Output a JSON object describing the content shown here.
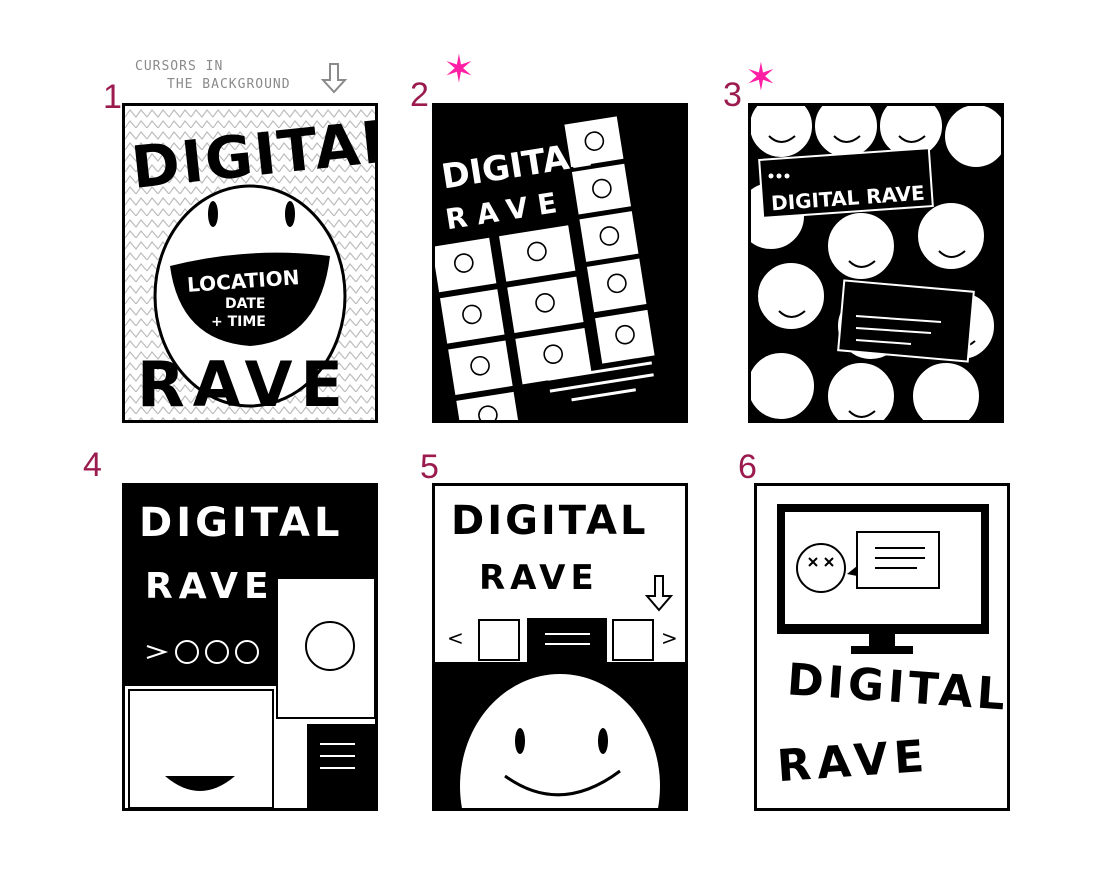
{
  "colors": {
    "ink": "#000000",
    "paper": "#ffffff",
    "number": "#9b1b4f",
    "star": "#ff1fa5",
    "note": "#8a8a8a"
  },
  "annotation": {
    "line1": "CURSORS IN",
    "line2": "THE BACKGROUND",
    "arrow_icon": "arrow-down-icon"
  },
  "panels": [
    {
      "number": "1",
      "title": "DIGITAL",
      "title2": "RAVE",
      "mouth_1": "LOCATION",
      "mouth_2": "DATE",
      "mouth_3": "+ TIME"
    },
    {
      "number": "2",
      "starred": true,
      "title": "DIGITAL",
      "title2": "RAVE"
    },
    {
      "number": "3",
      "starred": true,
      "title": "DIGITAL RAVE"
    },
    {
      "number": "4",
      "title": "DIGITAL",
      "title2": "RAVE"
    },
    {
      "number": "5",
      "title": "DIGITAL",
      "title2": "RAVE",
      "nav_prev": "<",
      "nav_next": ">"
    },
    {
      "number": "6",
      "title": "DIGITAL",
      "title2": "RAVE"
    }
  ]
}
